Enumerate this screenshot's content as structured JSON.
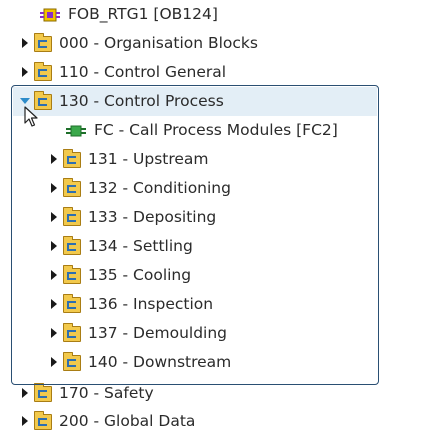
{
  "tree": {
    "items": [
      {
        "label": "FOB_RTG1 [OB124]",
        "icon": "ob-block-icon",
        "expander": "none",
        "level": 1
      },
      {
        "label": "000 - Organisation Blocks",
        "icon": "folder-icon",
        "expander": "collapsed",
        "level": 0
      },
      {
        "label": "110 - Control General",
        "icon": "folder-icon",
        "expander": "collapsed",
        "level": 0
      },
      {
        "label": "130 - Control Process",
        "icon": "folder-icon",
        "expander": "expanded",
        "level": 0,
        "selected": true
      },
      {
        "label": "FC - Call Process Modules [FC2]",
        "icon": "fc-block-icon",
        "expander": "none",
        "level": 2
      },
      {
        "label": "131 - Upstream",
        "icon": "folder-icon",
        "expander": "collapsed",
        "level": 1
      },
      {
        "label": "132 - Conditioning",
        "icon": "folder-icon",
        "expander": "collapsed",
        "level": 1
      },
      {
        "label": "133 - Depositing",
        "icon": "folder-icon",
        "expander": "collapsed",
        "level": 1
      },
      {
        "label": "134 - Settling",
        "icon": "folder-icon",
        "expander": "collapsed",
        "level": 1
      },
      {
        "label": "135 - Cooling",
        "icon": "folder-icon",
        "expander": "collapsed",
        "level": 1
      },
      {
        "label": "136 - Inspection",
        "icon": "folder-icon",
        "expander": "collapsed",
        "level": 1
      },
      {
        "label": "137 - Demoulding",
        "icon": "folder-icon",
        "expander": "collapsed",
        "level": 1
      },
      {
        "label": "140 - Downstream",
        "icon": "folder-icon",
        "expander": "collapsed",
        "level": 1
      },
      {
        "label": "170 - Safety",
        "icon": "folder-icon",
        "expander": "collapsed",
        "level": 0
      },
      {
        "label": "200 - Global Data",
        "icon": "folder-icon",
        "expander": "collapsed",
        "level": 0
      }
    ]
  },
  "colors": {
    "selection_border": "#2a4f73",
    "selected_row": "#e3eef6",
    "expand_arrow": "#2d8bc9",
    "folder": "#f2c94c"
  }
}
